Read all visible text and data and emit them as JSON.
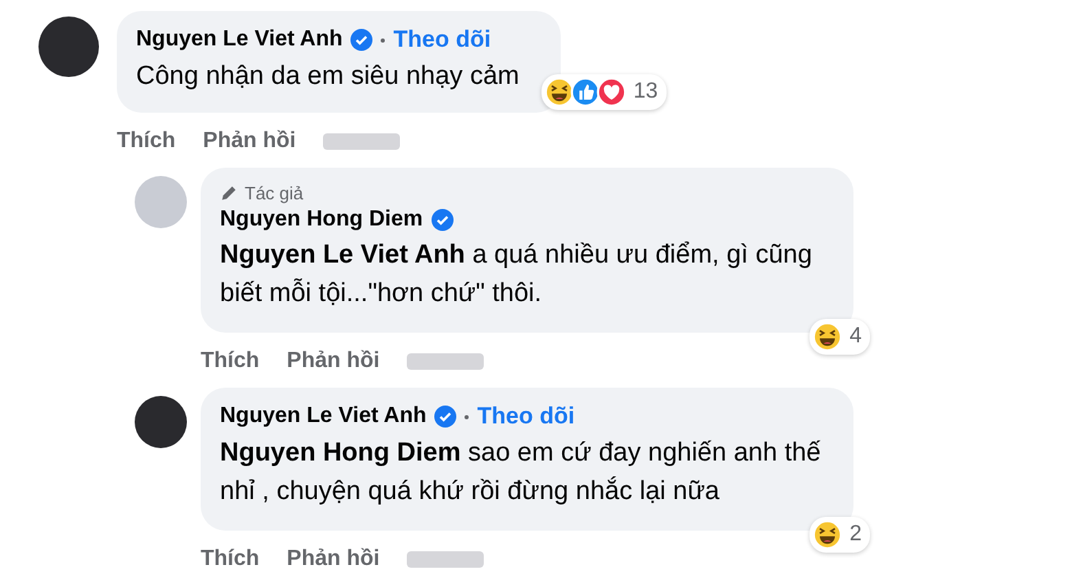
{
  "comments": [
    {
      "author": "Nguyen Le Viet Anh",
      "verified": true,
      "follow": "Theo dõi",
      "text": "Công nhận da em siêu nhạy cảm",
      "reactions": [
        {
          "kind": "haha"
        },
        {
          "kind": "like"
        },
        {
          "kind": "love"
        }
      ],
      "reaction_count": "13",
      "actions": [
        "Thích",
        "Phản hồi"
      ],
      "children": [
        {
          "author": "Nguyen Hong Diem",
          "verified": true,
          "author_badge": "Tác giả",
          "text": "**Nguyen Le Viet Anh** a quá nhiều ưu điểm, gì cũng biết mỗi tội...\"hơn chứ\" thôi.",
          "reactions": [
            {
              "kind": "haha"
            }
          ],
          "reaction_count": "4",
          "actions": [
            "Thích",
            "Phản hồi"
          ]
        },
        {
          "author": "Nguyen Le Viet Anh",
          "verified": true,
          "follow": "Theo dõi",
          "text": "**Nguyen Hong Diem** sao em cứ đay nghiến anh thế nhỉ , chuyện quá khứ rồi đừng nhắc lại nữa",
          "reactions": [
            {
              "kind": "haha"
            }
          ],
          "reaction_count": "2",
          "actions": [
            "Thích",
            "Phản hồi"
          ]
        }
      ]
    }
  ]
}
